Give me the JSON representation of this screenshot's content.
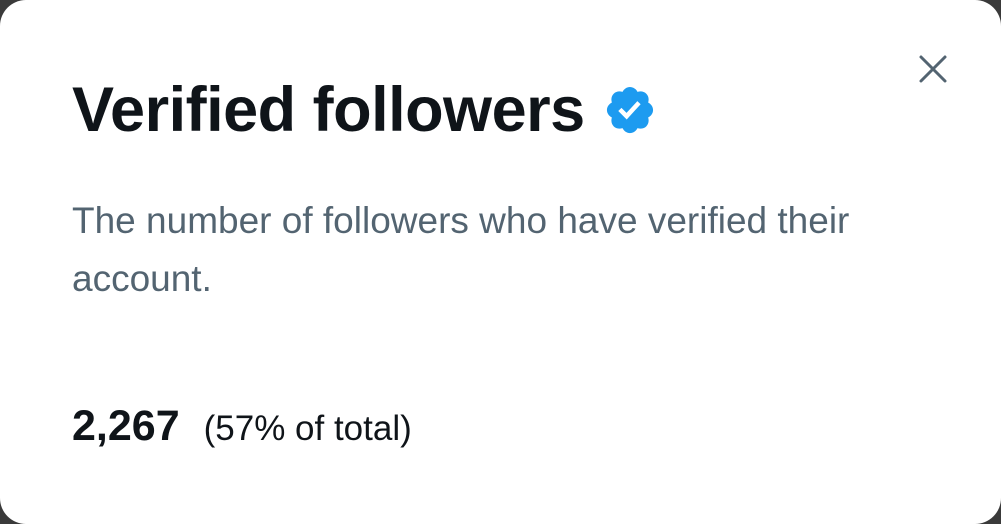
{
  "dialog": {
    "title": "Verified followers",
    "title_badge_icon": "verified-badge-icon",
    "description": "The number of followers who have verified their account.",
    "close_icon": "close-icon",
    "stat": {
      "count": "2,267",
      "percent_text": "(57% of total)"
    }
  },
  "colors": {
    "badge": "#1d9bf0",
    "title_text": "#0f1419",
    "secondary_text": "#536471",
    "close_icon": "#536471",
    "background": "#ffffff"
  }
}
